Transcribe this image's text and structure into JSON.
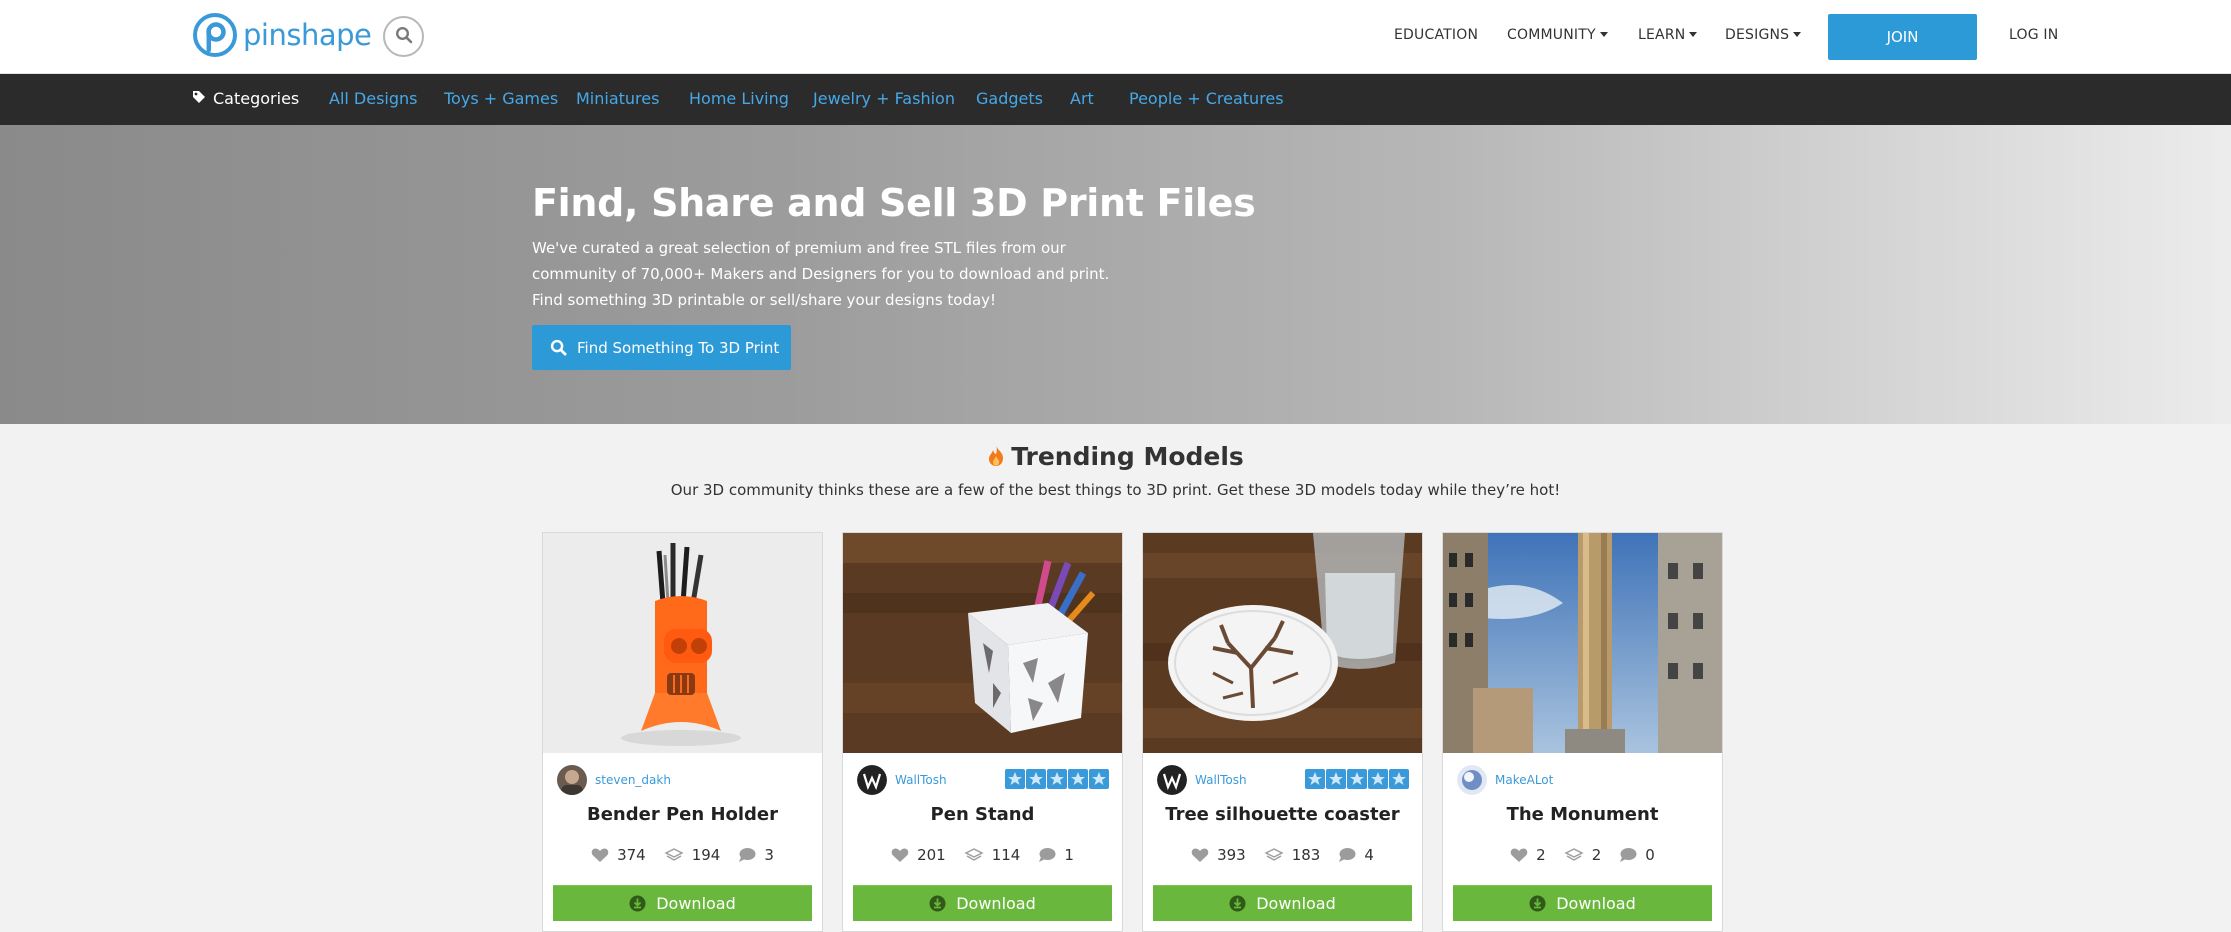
{
  "header": {
    "logo_text": "pinshape",
    "nav": [
      {
        "label": "EDUCATION",
        "dropdown": false
      },
      {
        "label": "COMMUNITY",
        "dropdown": true
      },
      {
        "label": "LEARN",
        "dropdown": true
      },
      {
        "label": "DESIGNS",
        "dropdown": true
      }
    ],
    "join_label": "JOIN",
    "login_label": "LOG IN"
  },
  "categories": {
    "heading": "Categories",
    "links": [
      "All Designs",
      "Toys + Games",
      "Miniatures",
      "Home Living",
      "Jewelry + Fashion",
      "Gadgets",
      "Art",
      "People + Creatures"
    ]
  },
  "hero": {
    "title": "Find, Share and Sell 3D Print Files",
    "description": "We've curated a great selection of premium and free STL files from our community of 70,000+ Makers and Designers for you to download and print. Find something 3D printable or sell/share your designs today!",
    "button_label": "Find Something To 3D Print"
  },
  "trending": {
    "title": "Trending Models",
    "subtitle": "Our 3D community thinks these are a few of the best things to 3D print. Get these 3D models today while they’re hot!",
    "cards": [
      {
        "author": "steven_dakh",
        "name": "Bender Pen Holder",
        "likes": "374",
        "downloads": "194",
        "comments": "3",
        "rating_stars": 0,
        "download_label": "Download"
      },
      {
        "author": "WallTosh",
        "name": "Pen Stand",
        "likes": "201",
        "downloads": "114",
        "comments": "1",
        "rating_stars": 5,
        "download_label": "Download"
      },
      {
        "author": "WallTosh",
        "name": "Tree silhouette coaster",
        "likes": "393",
        "downloads": "183",
        "comments": "4",
        "rating_stars": 5,
        "download_label": "Download"
      },
      {
        "author": "MakeALot",
        "name": "The Monument",
        "likes": "2",
        "downloads": "2",
        "comments": "0",
        "rating_stars": 0,
        "download_label": "Download"
      }
    ]
  },
  "colors": {
    "brand_blue": "#2d9ad8",
    "link_blue": "#46a8e8",
    "category_bar": "#2b2b2b",
    "download_green": "#69b83d",
    "flame_orange": "#f07b1d",
    "star_blue": "#3a9ad9"
  },
  "icons": {
    "logo": "pinshape-p-logo-icon",
    "search": "search-icon",
    "category_tag": "tag-icon",
    "trending": "flame-icon",
    "like": "heart-icon",
    "downloads": "layers-download-icon",
    "comments": "comment-bubble-icon",
    "download": "download-circle-icon",
    "rating": "star-icon"
  }
}
